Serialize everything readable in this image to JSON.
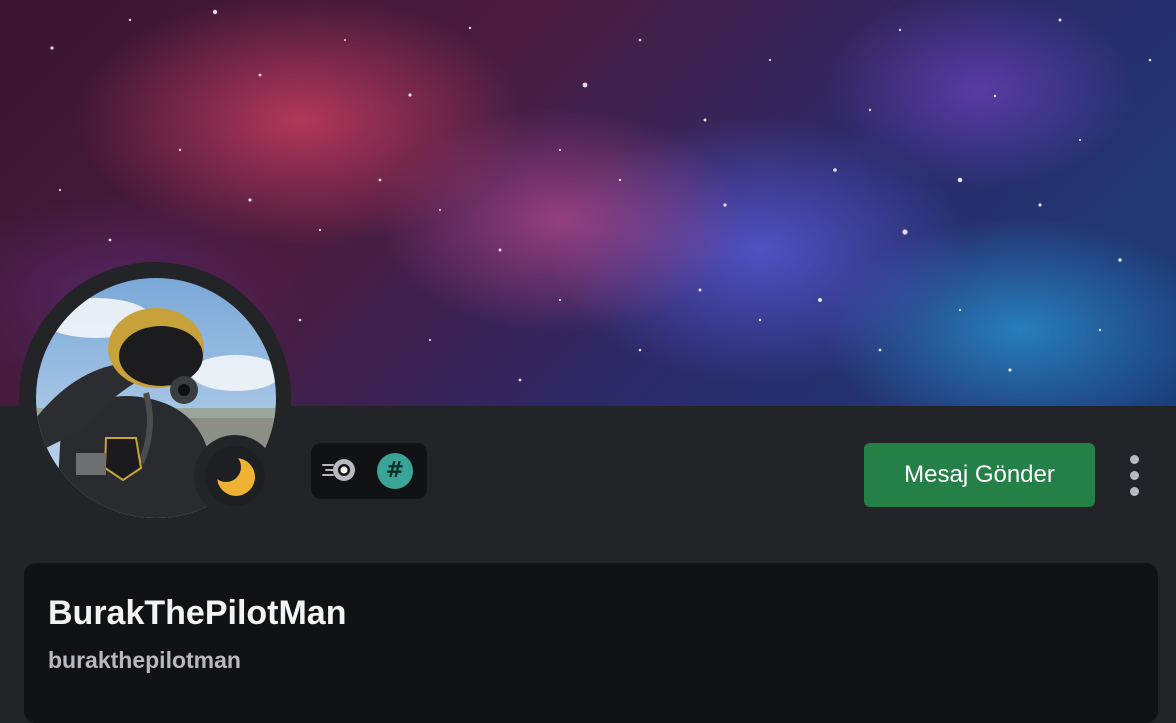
{
  "profile": {
    "display_name": "BurakThePilotMan",
    "username": "burakthepilotman",
    "status": "idle",
    "badges": [
      "nitro-badge",
      "hypesquad-hash-badge"
    ]
  },
  "actions": {
    "message_label": "Mesaj Gönder"
  },
  "colors": {
    "background": "#232428",
    "card": "#111214",
    "primary_button": "#248046",
    "idle_status": "#f0b232",
    "hash_badge": "#3aa597"
  },
  "icons": {
    "more": "more-vertical-icon",
    "status": "moon-icon"
  }
}
